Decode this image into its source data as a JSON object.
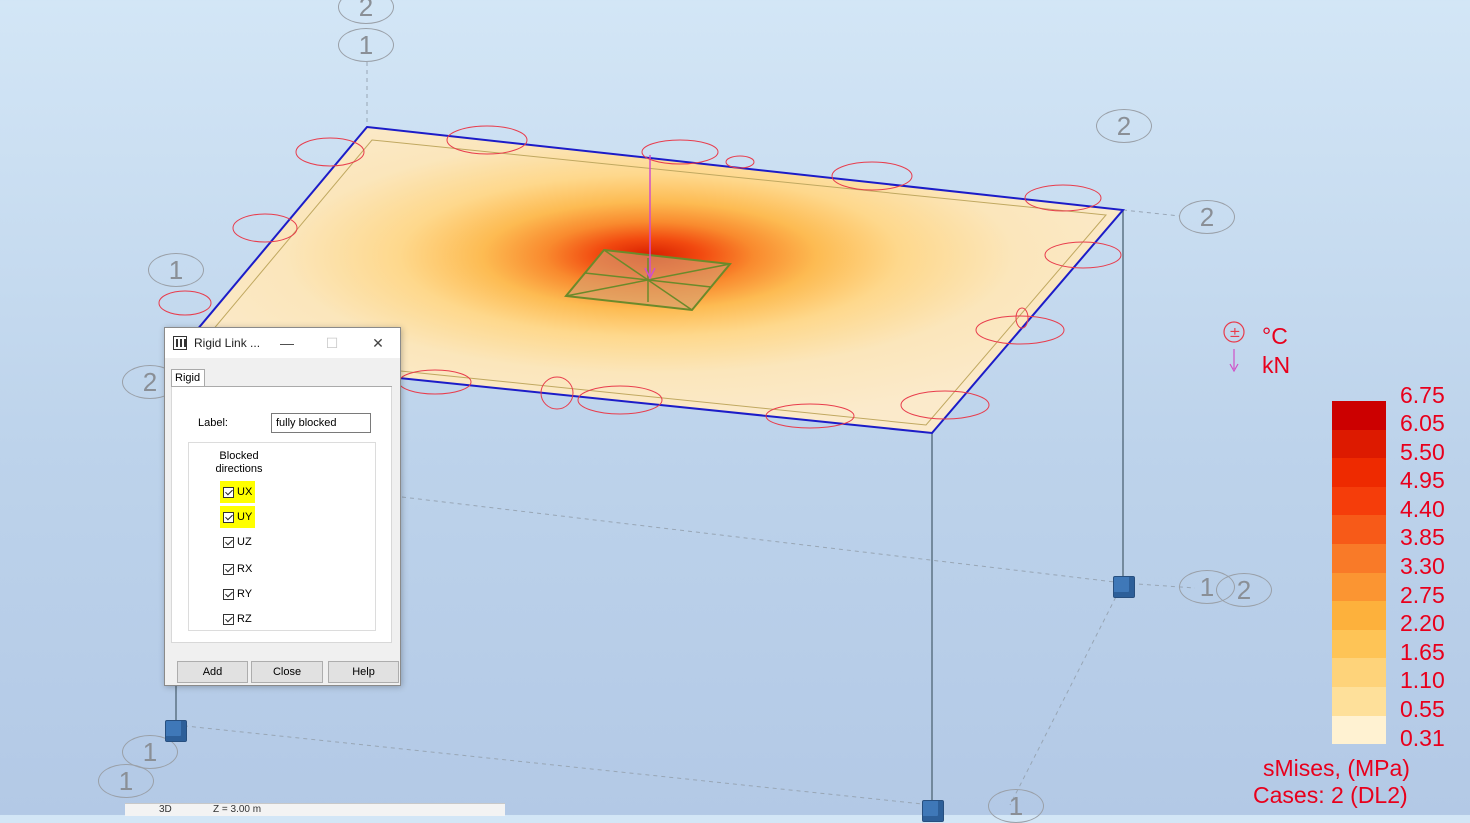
{
  "viewport": {
    "grid_labels": [
      "2",
      "1",
      "1",
      "2",
      "2",
      "2",
      "1",
      "2",
      "1",
      "1",
      "1"
    ],
    "load_units": [
      "°C",
      "kN"
    ],
    "colors": {
      "plate_light": "#fbe9c0",
      "plate_edge": "#1c1cc8",
      "load_arrow": "#d050c8",
      "annotation": "#e83c4c"
    }
  },
  "dialog": {
    "title": "Rigid Link ...",
    "tab": "Rigid",
    "label_caption": "Label:",
    "label_value": "fully blocked",
    "group_title": "Blocked directions",
    "directions": [
      {
        "name": "UX",
        "checked": true,
        "highlighted": true
      },
      {
        "name": "UY",
        "checked": true,
        "highlighted": true
      },
      {
        "name": "UZ",
        "checked": true,
        "highlighted": false
      },
      {
        "name": "RX",
        "checked": true,
        "highlighted": false
      },
      {
        "name": "RY",
        "checked": true,
        "highlighted": false
      },
      {
        "name": "RZ",
        "checked": true,
        "highlighted": false
      }
    ],
    "buttons": {
      "add": "Add",
      "close": "Close",
      "help": "Help"
    },
    "window_controls": {
      "minimize": "—",
      "maximize": "☐",
      "close": "✕"
    }
  },
  "legend": {
    "values": [
      "6.75",
      "6.05",
      "5.50",
      "4.95",
      "4.40",
      "3.85",
      "3.30",
      "2.75",
      "2.20",
      "1.65",
      "1.10",
      "0.55",
      "0.31"
    ],
    "colors": [
      "#cc0000",
      "#dd1a00",
      "#ee2a00",
      "#f53d0a",
      "#f75a18",
      "#f97a28",
      "#fb9532",
      "#fdb13c",
      "#fec456",
      "#fed37a",
      "#fee09a",
      "#fee8b2",
      "#fff2d2"
    ],
    "title": "sMises, (MPa)",
    "cases": "Cases: 2 (DL2)"
  },
  "statusbar": {
    "view": "3D",
    "level": "Z = 3.00 m"
  }
}
